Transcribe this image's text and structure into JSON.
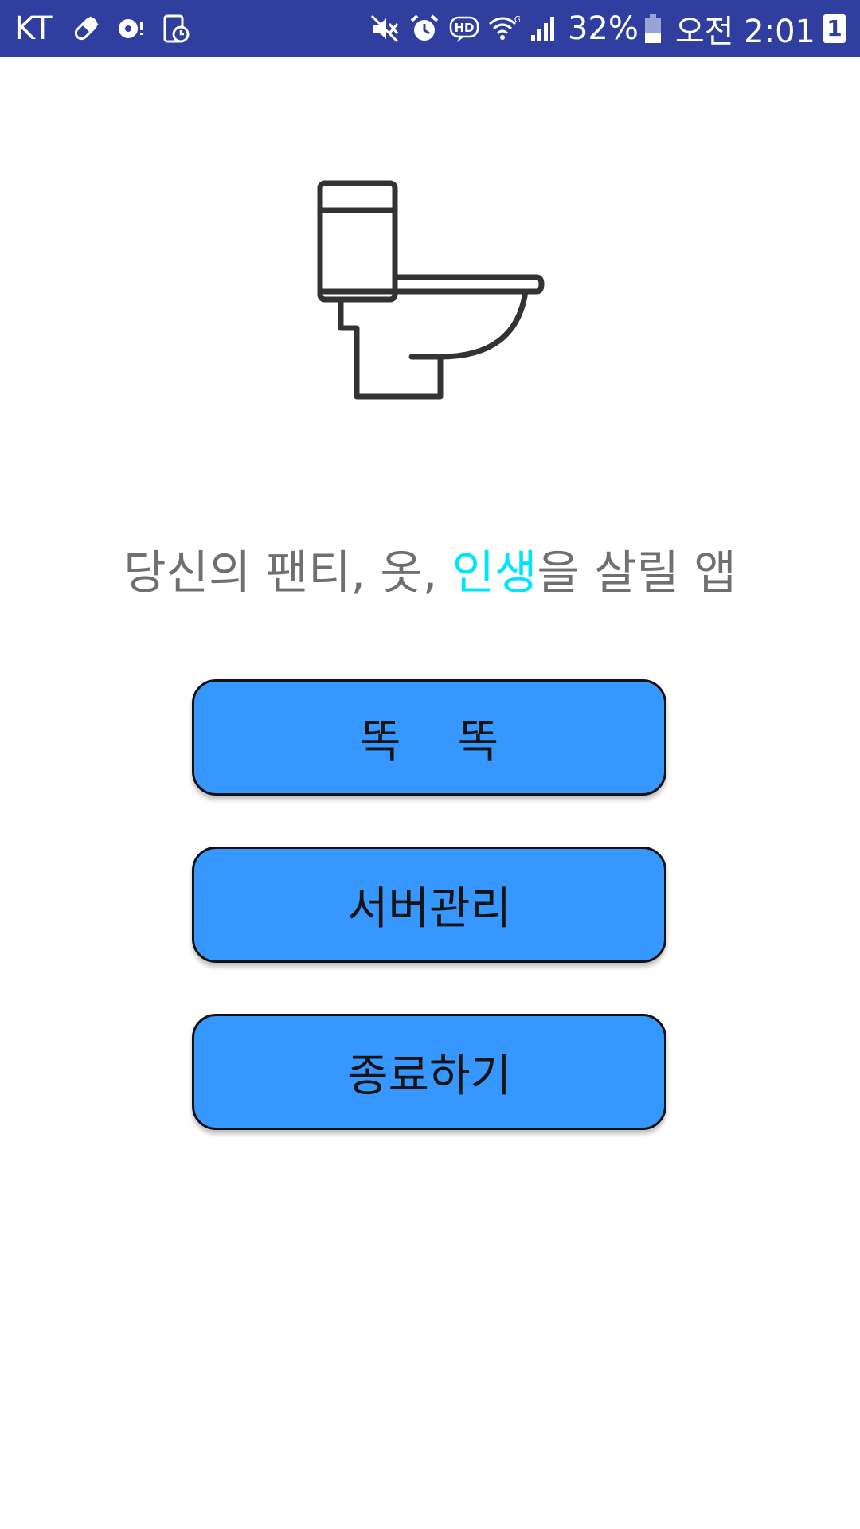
{
  "status_bar": {
    "carrier": "KT",
    "battery_percent": "32%",
    "clock": "오전 2:01",
    "notification_count": "1",
    "left_icons": [
      "pill-icon",
      "sync-alert-icon",
      "phone-clock-icon"
    ],
    "right_icons": [
      "mute-icon",
      "alarm-icon",
      "hd-voice-icon",
      "wifi-icon",
      "signal-icon",
      "battery-icon"
    ],
    "background_color": "#303f9f"
  },
  "main": {
    "logo_icon": "toilet-icon",
    "tagline": {
      "part1": "당신의 팬티, 옷, ",
      "highlight": "인생",
      "part2": "을 살릴 앱",
      "highlight_color": "#00e5ff"
    },
    "buttons": [
      {
        "label": "똑    똑"
      },
      {
        "label": "서버관리"
      },
      {
        "label": "종료하기"
      }
    ],
    "button_color": "#3697ff"
  }
}
